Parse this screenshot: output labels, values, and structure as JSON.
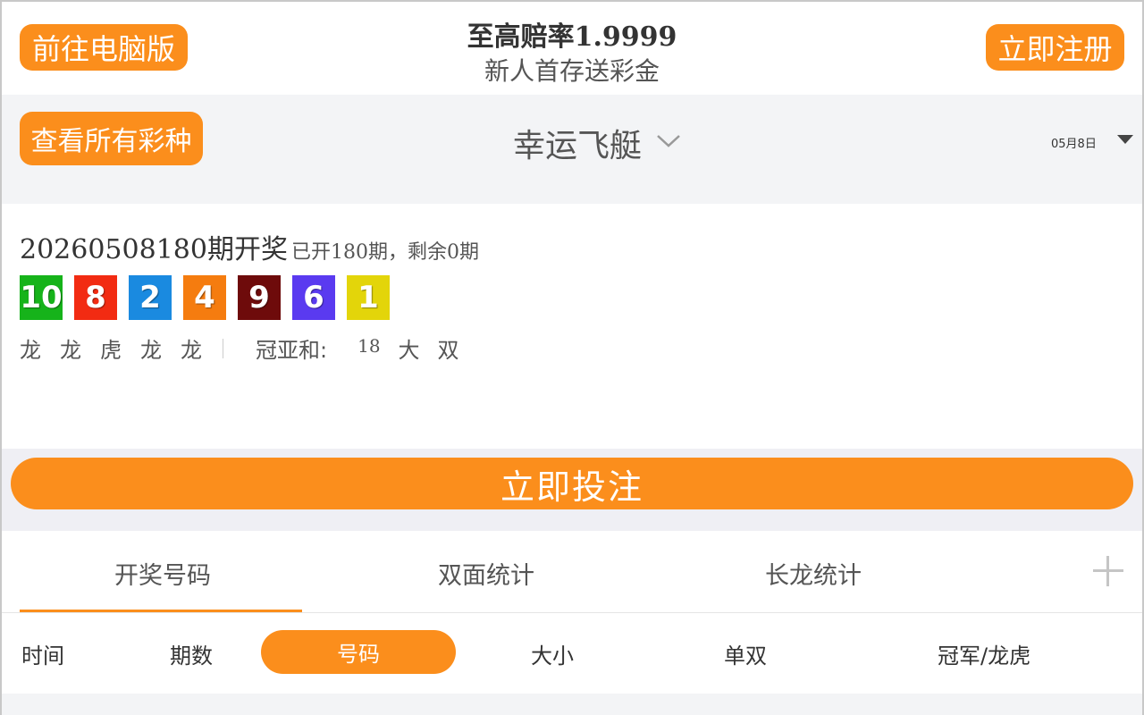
{
  "header": {
    "pc_button": "前往电脑版",
    "promo_title": "至高赔率1.9999",
    "promo_subtitle": "新人首存送彩金",
    "register_button": "立即注册"
  },
  "lottery_bar": {
    "all_lotteries_button": "查看所有彩种",
    "lottery_name": "幸运飞艇",
    "date": "05月8日"
  },
  "draw": {
    "period": "20260508180",
    "period_suffix": "期开奖",
    "count_text": "已开180期，剩余0期",
    "balls": [
      {
        "number": "10",
        "color": "#16b31a"
      },
      {
        "number": "8",
        "color": "#f22b12"
      },
      {
        "number": "2",
        "color": "#1a8ae0"
      },
      {
        "number": "4",
        "color": "#f57c0f"
      },
      {
        "number": "9",
        "color": "#6e0b0b"
      },
      {
        "number": "6",
        "color": "#5a3af0"
      },
      {
        "number": "1",
        "color": "#e3d50a"
      }
    ],
    "dragon_tiger": [
      "龙",
      "龙",
      "虎",
      "龙",
      "龙"
    ],
    "sum_label": "冠亚和:",
    "sum_value": "18",
    "sum_size": "大",
    "sum_parity": "双"
  },
  "bet_button": "立即投注",
  "tabs": [
    {
      "label": "开奖号码",
      "active": true
    },
    {
      "label": "双面统计",
      "active": false
    },
    {
      "label": "长龙统计",
      "active": false
    }
  ],
  "sub_tabs": {
    "time": "时间",
    "period": "期数",
    "number": "号码",
    "size": "大小",
    "parity": "单双",
    "champion_dragon_tiger": "冠军/龙虎"
  },
  "colors": {
    "accent": "#fb8e1c",
    "background_gray": "#f3f4f6"
  }
}
